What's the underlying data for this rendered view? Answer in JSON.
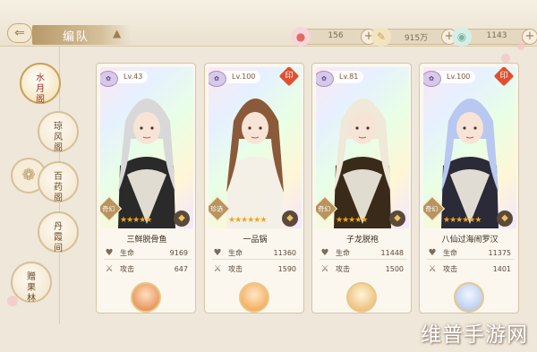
{
  "header": {
    "title": "编队",
    "resources": [
      {
        "icon": "peach-icon",
        "value": "156",
        "color": "#e06a6a"
      },
      {
        "icon": "brush-icon",
        "value": "915万",
        "color": "#c8a060"
      },
      {
        "icon": "jade-icon",
        "value": "1143",
        "color": "#7ab8a0"
      }
    ]
  },
  "sidebar": {
    "items": [
      {
        "label": "水月阁",
        "active": true
      },
      {
        "label": "琼风阁",
        "active": false
      },
      {
        "label": "百药阁",
        "active": false
      },
      {
        "label": "丹霞间",
        "active": false
      },
      {
        "label": "赠果林",
        "active": false
      }
    ]
  },
  "cards": [
    {
      "level": "Lv.43",
      "rank": "奇幻",
      "stars": "★★★★★",
      "name": "三鲜脱骨鱼",
      "hp_label": "生命",
      "hp": "9169",
      "atk_label": "攻击",
      "atk": "647",
      "hair": "#d8d8d8",
      "coat": "#2a2a2a",
      "seal": false
    },
    {
      "level": "Lv.100",
      "rank": "珍选",
      "stars": "★★★★★★",
      "name": "一品锅",
      "hp_label": "生命",
      "hp": "11360",
      "atk_label": "攻击",
      "atk": "1590",
      "hair": "#8a5a3a",
      "coat": "#f4f0e8",
      "seal": true
    },
    {
      "level": "Lv.81",
      "rank": "奇幻",
      "stars": "★★★★★",
      "name": "子龙脱袍",
      "hp_label": "生命",
      "hp": "11448",
      "atk_label": "攻击",
      "atk": "1500",
      "hair": "#f0e8d8",
      "coat": "#3a2a1a",
      "seal": false
    },
    {
      "level": "Lv.100",
      "rank": "奇幻",
      "stars": "★★★★★★",
      "name": "八仙过海闹罗汉",
      "hp_label": "生命",
      "hp": "11375",
      "atk_label": "攻击",
      "atk": "1401",
      "hair": "#b8c8f0",
      "coat": "#2a2a38",
      "seal": true
    }
  ],
  "watermark": "维普手游网"
}
